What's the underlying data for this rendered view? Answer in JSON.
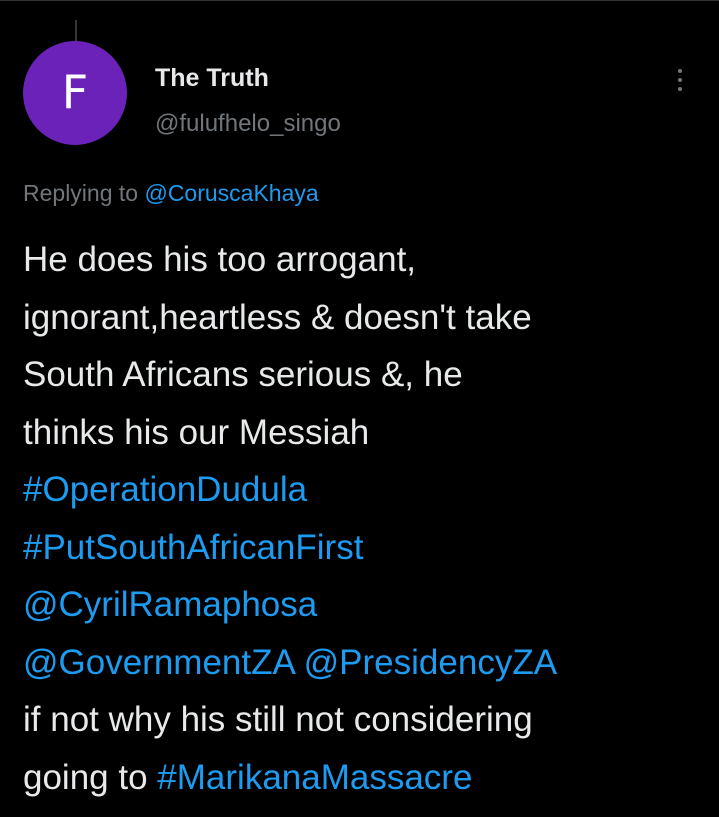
{
  "tweet": {
    "author": {
      "avatar_letter": "F",
      "avatar_color": "#6a22b8",
      "display_name": "The Truth",
      "handle": "@fulufhelo_singo"
    },
    "more_icon": "more-vertical-icon",
    "replying_prefix": "Replying to",
    "replying_to": "@CoruscaKhaya",
    "body": {
      "line1": "He does his too arrogant,",
      "line2": "ignorant,heartless & doesn't take",
      "line3": "South Africans serious &, he",
      "line4": "thinks his our Messiah",
      "hashtag_operation_dudula": "#OperationDudula",
      "hashtag_put_south_african_first": "#PutSouthAfricanFirst",
      "mention_cyril": "@CyrilRamaphosa",
      "mention_government": "@GovernmentZA",
      "mention_presidency": "@PresidencyZA",
      "line9": "if not why his still not considering",
      "line10_prefix": "going to",
      "hashtag_marikana": "#MarikanaMassacre"
    }
  },
  "colors": {
    "background": "#000000",
    "text_primary": "#e7e9ea",
    "text_secondary": "#71767b",
    "link": "#1d9bf0"
  }
}
